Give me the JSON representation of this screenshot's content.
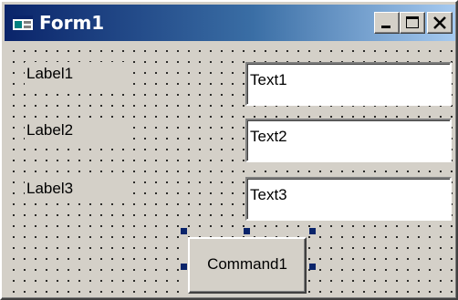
{
  "window": {
    "title": "Form1",
    "icon": "vb-form-icon",
    "buttons": [
      "minimize-icon",
      "maximize-icon",
      "close-icon"
    ]
  },
  "form": {
    "labels": [
      "Label1",
      "Label2",
      "Label3"
    ],
    "textboxes": [
      "Text1",
      "Text2",
      "Text3"
    ],
    "command_button": "Command1",
    "selected_control": "Command1"
  },
  "colors": {
    "titlebar_start": "#0a246a",
    "titlebar_end": "#a6caf0",
    "face": "#d4d0c8",
    "selection_handle": "#0a246a"
  }
}
